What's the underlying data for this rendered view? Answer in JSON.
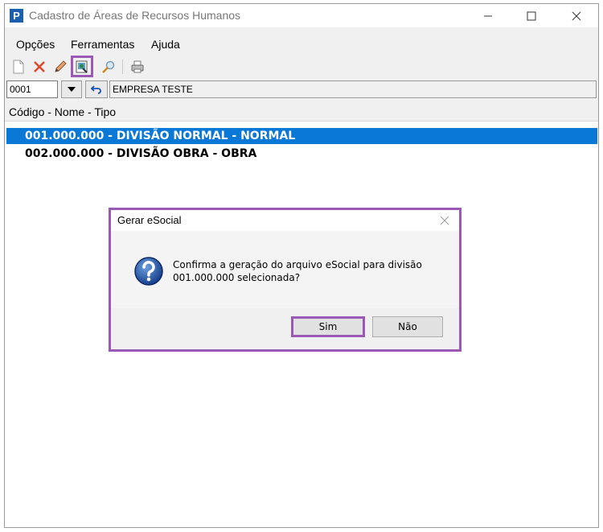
{
  "window": {
    "title": "Cadastro de Áreas de Recursos Humanos",
    "app_icon_letter": "P"
  },
  "menu": {
    "items": [
      "Opções",
      "Ferramentas",
      "Ajuda"
    ]
  },
  "toolbar": {
    "icons": [
      "new-document-icon",
      "delete-icon",
      "edit-pencil-icon",
      "generate-esocial-icon",
      "search-icon",
      "print-icon"
    ],
    "highlight_color": "#9b59b6"
  },
  "filter": {
    "company_code": "0001",
    "company_name": "EMPRESA TESTE"
  },
  "list": {
    "header": "Código - Nome - Tipo",
    "rows": [
      "001.000.000 - DIVISÃO NORMAL - NORMAL",
      "002.000.000 - DIVISÃO OBRA - OBRA"
    ],
    "selected_index": 0,
    "selection_color": "#0a78d7"
  },
  "dialog": {
    "title": "Gerar eSocial",
    "message_line1": "Confirma a geração do arquivo eSocial para divisão",
    "message_line2": "001.000.000 selecionada?",
    "yes_label": "Sim",
    "no_label": "Não",
    "icon": "question-icon"
  }
}
